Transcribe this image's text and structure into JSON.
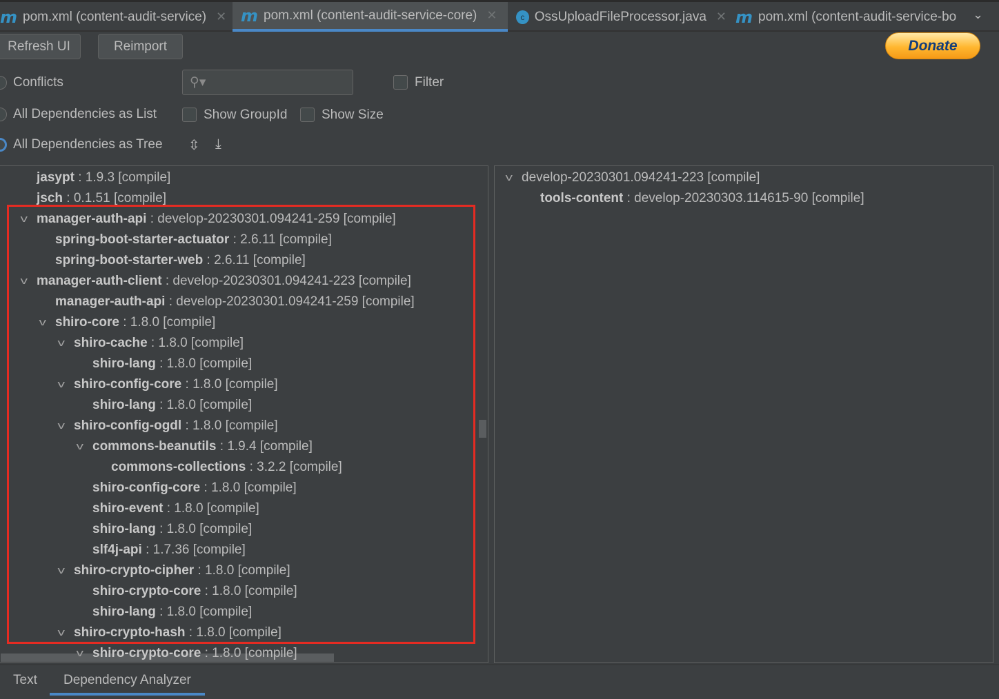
{
  "tabs": [
    {
      "label": "pom.xml (content-audit-service)",
      "icon": "maven-icon",
      "active": false
    },
    {
      "label": "pom.xml (content-audit-service-core)",
      "icon": "maven-icon",
      "active": true
    },
    {
      "label": "OssUploadFileProcessor.java",
      "icon": "class-icon",
      "active": false
    },
    {
      "label": "pom.xml (content-audit-service-bo",
      "icon": "maven-icon",
      "active": false
    }
  ],
  "toolbar": {
    "refresh": "Refresh UI",
    "reimport": "Reimport",
    "donate": "Donate"
  },
  "options": {
    "conflicts": "Conflicts",
    "list": "All Dependencies as List",
    "tree": "All Dependencies as Tree",
    "filter": "Filter",
    "show_groupid": "Show GroupId",
    "show_size": "Show Size",
    "search_placeholder": ""
  },
  "left_tree": [
    {
      "name": "jasypt",
      "version": " : 1.9.3 [compile]",
      "level": 0,
      "expandable": false
    },
    {
      "name": "jsch",
      "version": " : 0.1.51 [compile]",
      "level": 0,
      "expandable": false
    },
    {
      "name": "manager-auth-api",
      "version": " : develop-20230301.094241-259 [compile]",
      "level": 0,
      "expandable": true
    },
    {
      "name": "spring-boot-starter-actuator",
      "version": " : 2.6.11 [compile]",
      "level": 1,
      "expandable": false
    },
    {
      "name": "spring-boot-starter-web",
      "version": " : 2.6.11 [compile]",
      "level": 1,
      "expandable": false
    },
    {
      "name": "manager-auth-client",
      "version": " : develop-20230301.094241-223 [compile]",
      "level": 0,
      "expandable": true
    },
    {
      "name": "manager-auth-api",
      "version": " : develop-20230301.094241-259 [compile]",
      "level": 1,
      "expandable": false
    },
    {
      "name": "shiro-core",
      "version": " : 1.8.0 [compile]",
      "level": 1,
      "expandable": true
    },
    {
      "name": "shiro-cache",
      "version": " : 1.8.0 [compile]",
      "level": 2,
      "expandable": true
    },
    {
      "name": "shiro-lang",
      "version": " : 1.8.0 [compile]",
      "level": 3,
      "expandable": false
    },
    {
      "name": "shiro-config-core",
      "version": " : 1.8.0 [compile]",
      "level": 2,
      "expandable": true
    },
    {
      "name": "shiro-lang",
      "version": " : 1.8.0 [compile]",
      "level": 3,
      "expandable": false
    },
    {
      "name": "shiro-config-ogdl",
      "version": " : 1.8.0 [compile]",
      "level": 2,
      "expandable": true
    },
    {
      "name": "commons-beanutils",
      "version": " : 1.9.4 [compile]",
      "level": 3,
      "expandable": true
    },
    {
      "name": "commons-collections",
      "version": " : 3.2.2 [compile]",
      "level": 4,
      "expandable": false
    },
    {
      "name": "shiro-config-core",
      "version": " : 1.8.0 [compile]",
      "level": 3,
      "expandable": false
    },
    {
      "name": "shiro-event",
      "version": " : 1.8.0 [compile]",
      "level": 3,
      "expandable": false
    },
    {
      "name": "shiro-lang",
      "version": " : 1.8.0 [compile]",
      "level": 3,
      "expandable": false
    },
    {
      "name": "slf4j-api",
      "version": " : 1.7.36 [compile]",
      "level": 3,
      "expandable": false
    },
    {
      "name": "shiro-crypto-cipher",
      "version": " : 1.8.0 [compile]",
      "level": 2,
      "expandable": true
    },
    {
      "name": "shiro-crypto-core",
      "version": " : 1.8.0 [compile]",
      "level": 3,
      "expandable": false
    },
    {
      "name": "shiro-lang",
      "version": " : 1.8.0 [compile]",
      "level": 3,
      "expandable": false
    },
    {
      "name": "shiro-crypto-hash",
      "version": " : 1.8.0 [compile]",
      "level": 2,
      "expandable": true
    },
    {
      "name": "shiro-crypto-core",
      "version": " : 1.8.0 [compile]",
      "level": 3,
      "expandable": true
    }
  ],
  "right_tree": [
    {
      "name": "",
      "version": "develop-20230301.094241-223 [compile]",
      "level": 0,
      "expandable": true
    },
    {
      "name": "tools-content",
      "version": " : develop-20230303.114615-90 [compile]",
      "level": 1,
      "expandable": false
    }
  ],
  "bottom_tabs": [
    {
      "label": "Text",
      "active": false
    },
    {
      "label": "Dependency Analyzer",
      "active": true
    }
  ],
  "colors": {
    "accent": "#4a88c7",
    "highlight": "#e52b22",
    "maven": "#3592c4"
  }
}
